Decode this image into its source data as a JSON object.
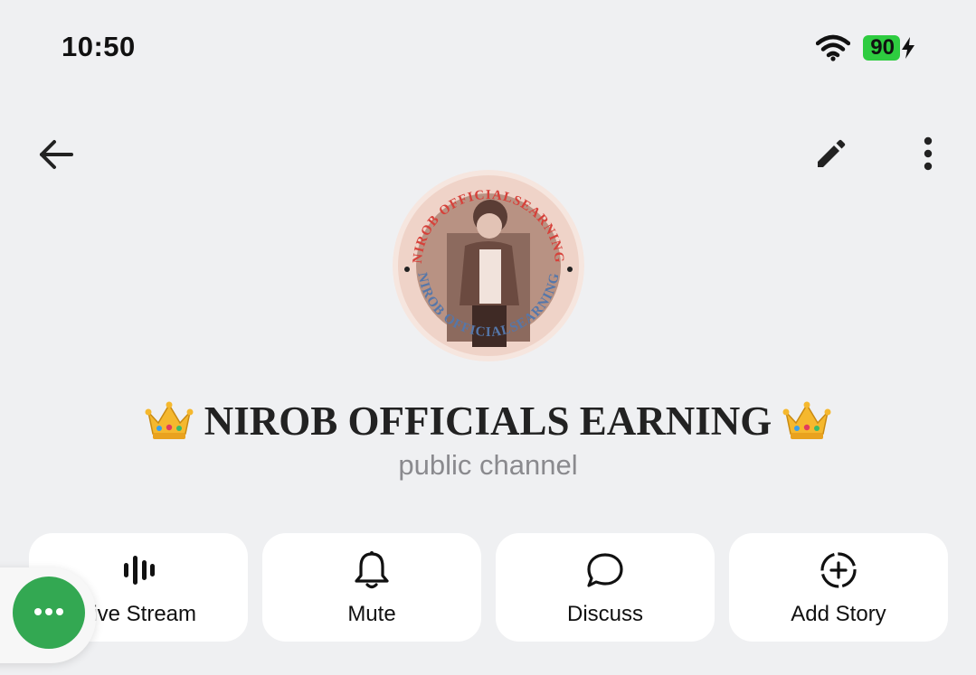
{
  "status_bar": {
    "time": "10:50",
    "battery": "90",
    "icons": [
      "wifi-icon",
      "charging-bolt-icon"
    ],
    "battery_color": "#2ecc40"
  },
  "nav": {
    "icons": [
      "back-arrow-icon",
      "edit-pencil-icon",
      "more-vertical-icon"
    ]
  },
  "channel": {
    "title": "NIROB OFFICIALS EARNING",
    "subtitle": "public channel",
    "title_emoji": "crown-icon",
    "avatar_text": "NIROB OFFICIALSEARNING"
  },
  "actions": [
    {
      "label": "Live Stream",
      "icon": "live-stream-icon"
    },
    {
      "label": "Mute",
      "icon": "bell-icon"
    },
    {
      "label": "Discuss",
      "icon": "chat-bubble-icon"
    },
    {
      "label": "Add Story",
      "icon": "add-story-icon"
    }
  ],
  "floating_button": {
    "icon": "more-horizontal-icon",
    "color": "#33a852"
  },
  "colors": {
    "background": "#eff0f2",
    "card": "#ffffff",
    "subtitle": "#8a8a8e"
  }
}
